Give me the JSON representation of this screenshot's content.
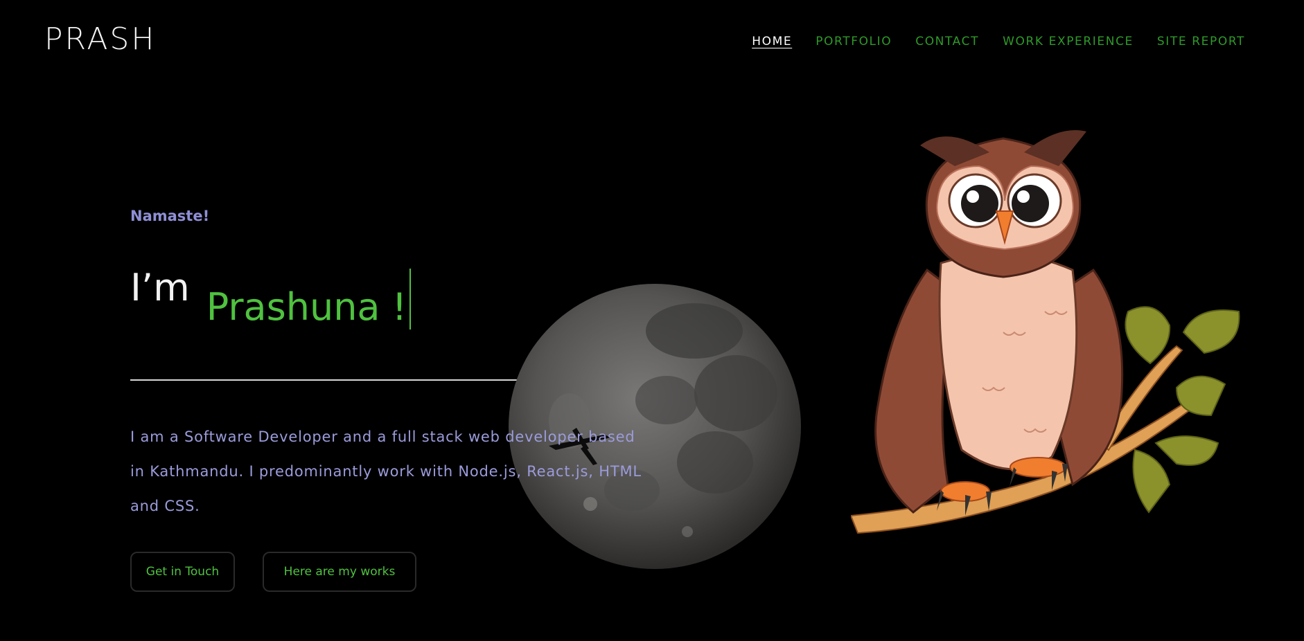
{
  "header": {
    "logo": "PRASH",
    "nav": [
      {
        "label": "HOME",
        "active": true
      },
      {
        "label": "PORTFOLIO",
        "active": false
      },
      {
        "label": "CONTACT",
        "active": false
      },
      {
        "label": "WORK EXPERIENCE",
        "active": false
      },
      {
        "label": "SITE REPORT",
        "active": false
      }
    ]
  },
  "hero": {
    "greeting": "Namaste!",
    "im": "I’m",
    "name": "Prashuna !",
    "bio": "I am a Software Developer and a full stack web developer based in Kathmandu. I predominantly work with Node.js, React.js, HTML and CSS."
  },
  "buttons": {
    "touch": "Get in Touch",
    "works": "Here are my works"
  },
  "colors": {
    "background": "#000000",
    "accent_green": "#4fc23f",
    "nav_green": "#2f9a2a",
    "lavender": "#9b9bdc"
  },
  "illustrations": {
    "moon": "moon-image",
    "owl": "owl-on-branch-image"
  }
}
